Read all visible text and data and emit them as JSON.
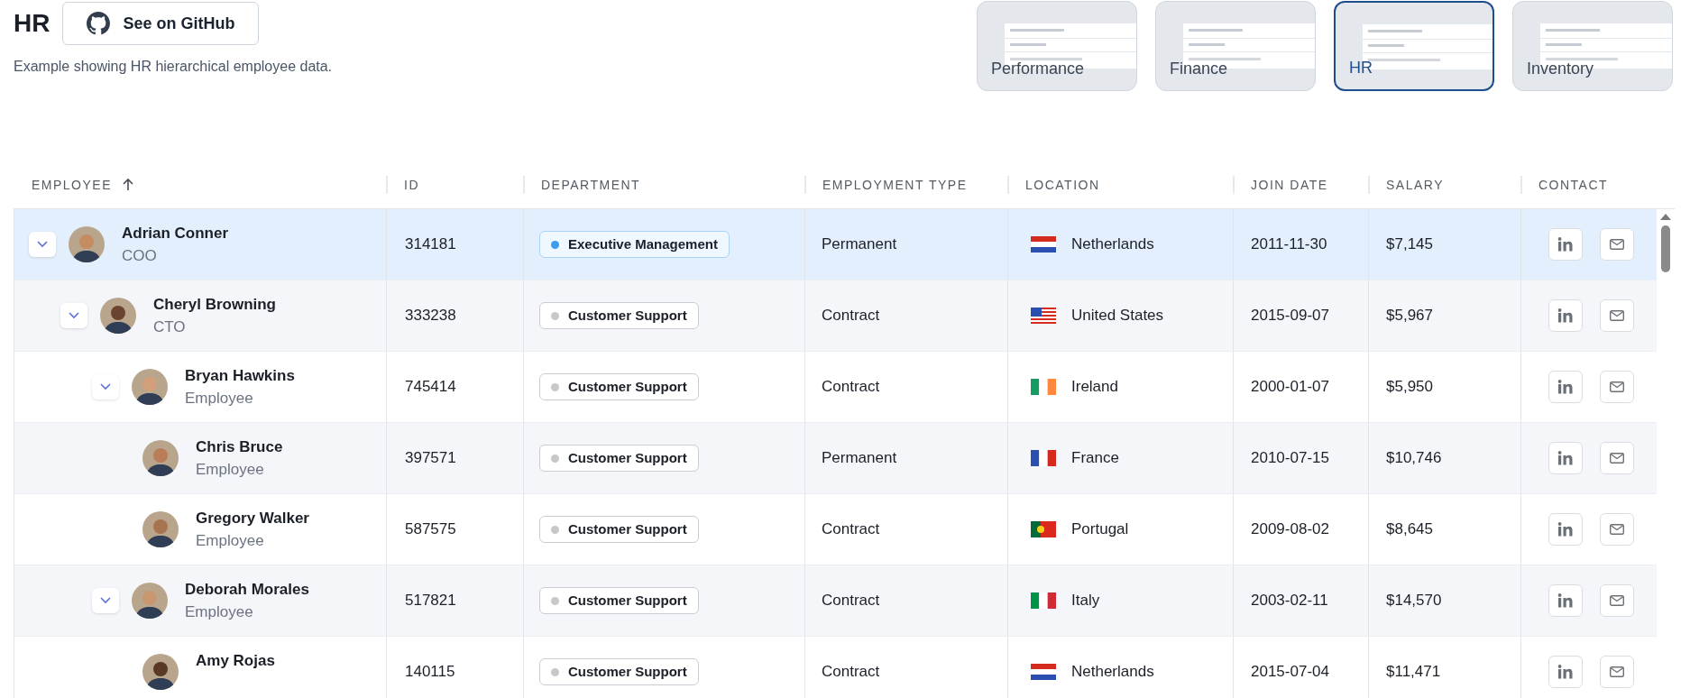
{
  "header": {
    "title": "HR",
    "github_button": "See on GitHub",
    "description": "Example showing HR hierarchical employee data."
  },
  "examples": [
    {
      "label": "Performance",
      "selected": false
    },
    {
      "label": "Finance",
      "selected": false
    },
    {
      "label": "HR",
      "selected": true
    },
    {
      "label": "Inventory",
      "selected": false
    }
  ],
  "table": {
    "columns": [
      {
        "label": "EMPLOYEE",
        "sorted": true
      },
      {
        "label": "ID",
        "sorted": false
      },
      {
        "label": "DEPARTMENT",
        "sorted": false
      },
      {
        "label": "EMPLOYMENT TYPE",
        "sorted": false
      },
      {
        "label": "LOCATION",
        "sorted": false
      },
      {
        "label": "JOIN DATE",
        "sorted": false
      },
      {
        "label": "SALARY",
        "sorted": false
      },
      {
        "label": "CONTACT",
        "sorted": false
      }
    ],
    "rows": [
      {
        "name": "Adrian Conner",
        "role": "COO",
        "id": "314181",
        "department": {
          "label": "Executive Management",
          "color": "#3b9cf0"
        },
        "employment_type": "Permanent",
        "location": {
          "country": "Netherlands",
          "flag": {
            "kind": "horizontal",
            "stripes": [
              {
                "color": "#d52b1e"
              },
              {
                "color": "#ffffff"
              },
              {
                "color": "#2a4fb0"
              }
            ]
          }
        },
        "join_date": "2011-11-30",
        "salary": "$7,145",
        "selected": true,
        "expanded": true,
        "children": [
          {
            "name": "Cheryl Browning",
            "role": "CTO",
            "id": "333238",
            "department": {
              "label": "Customer Support",
              "color": "#c8c8c8"
            },
            "employment_type": "Contract",
            "location": {
              "country": "United States",
              "flag": {
                "kind": "stars_stripes",
                "stripes": [
                  {
                    "color": "#d52b1e"
                  },
                  {
                    "color": "#ffffff"
                  },
                  {
                    "color": "#2a4fb0"
                  }
                ]
              }
            },
            "join_date": "2015-09-07",
            "salary": "$5,967",
            "selected": false,
            "expanded": true,
            "children": [
              {
                "name": "Bryan Hawkins",
                "role": "Employee",
                "id": "745414",
                "department": {
                  "label": "Customer Support",
                  "color": "#c8c8c8"
                },
                "employment_type": "Contract",
                "location": {
                  "country": "Ireland",
                  "flag": {
                    "kind": "vertical",
                    "stripes": [
                      {
                        "color": "#169b62"
                      },
                      {
                        "color": "#ffffff"
                      },
                      {
                        "color": "#ff883e"
                      }
                    ]
                  }
                },
                "join_date": "2000-01-07",
                "salary": "$5,950",
                "selected": false,
                "expanded": true,
                "children": [
                  {
                    "name": "Chris Bruce",
                    "role": "Employee",
                    "id": "397571",
                    "department": {
                      "label": "Customer Support",
                      "color": "#c8c8c8"
                    },
                    "employment_type": "Permanent",
                    "location": {
                      "country": "France",
                      "flag": {
                        "kind": "vertical",
                        "stripes": [
                          {
                            "color": "#2a4fb0"
                          },
                          {
                            "color": "#ffffff"
                          },
                          {
                            "color": "#d52b1e"
                          }
                        ]
                      }
                    },
                    "join_date": "2010-07-15",
                    "salary": "$10,746",
                    "selected": false
                  },
                  {
                    "name": "Gregory Walker",
                    "role": "Employee",
                    "id": "587575",
                    "department": {
                      "label": "Customer Support",
                      "color": "#c8c8c8"
                    },
                    "employment_type": "Contract",
                    "location": {
                      "country": "Portugal",
                      "flag": {
                        "kind": "vertical_two",
                        "stripes": [
                          {
                            "color": "#046a38"
                          },
                          {
                            "color": "#da291c"
                          }
                        ]
                      }
                    },
                    "join_date": "2009-08-02",
                    "salary": "$8,645",
                    "selected": false
                  }
                ]
              },
              {
                "name": "Deborah Morales",
                "role": "Employee",
                "id": "517821",
                "department": {
                  "label": "Customer Support",
                  "color": "#c8c8c8"
                },
                "employment_type": "Contract",
                "location": {
                  "country": "Italy",
                  "flag": {
                    "kind": "vertical",
                    "stripes": [
                      {
                        "color": "#009246"
                      },
                      {
                        "color": "#ffffff"
                      },
                      {
                        "color": "#ce2b37"
                      }
                    ]
                  }
                },
                "join_date": "2003-02-11",
                "salary": "$14,570",
                "selected": false,
                "expanded": true,
                "children": [
                  {
                    "name": "Amy Rojas",
                    "id": "140115",
                    "department": {
                      "label": "Customer Support",
                      "color": "#c8c8c8"
                    },
                    "employment_type": "Contract",
                    "location": {
                      "country": "Netherlands",
                      "flag": {
                        "kind": "horizontal",
                        "stripes": [
                          {
                            "color": "#d52b1e"
                          },
                          {
                            "color": "#ffffff"
                          },
                          {
                            "color": "#2a4fb0"
                          }
                        ]
                      }
                    },
                    "join_date": "2015-07-04",
                    "salary": "$11,471",
                    "selected": false
                  }
                ]
              }
            ]
          }
        ]
      }
    ]
  }
}
